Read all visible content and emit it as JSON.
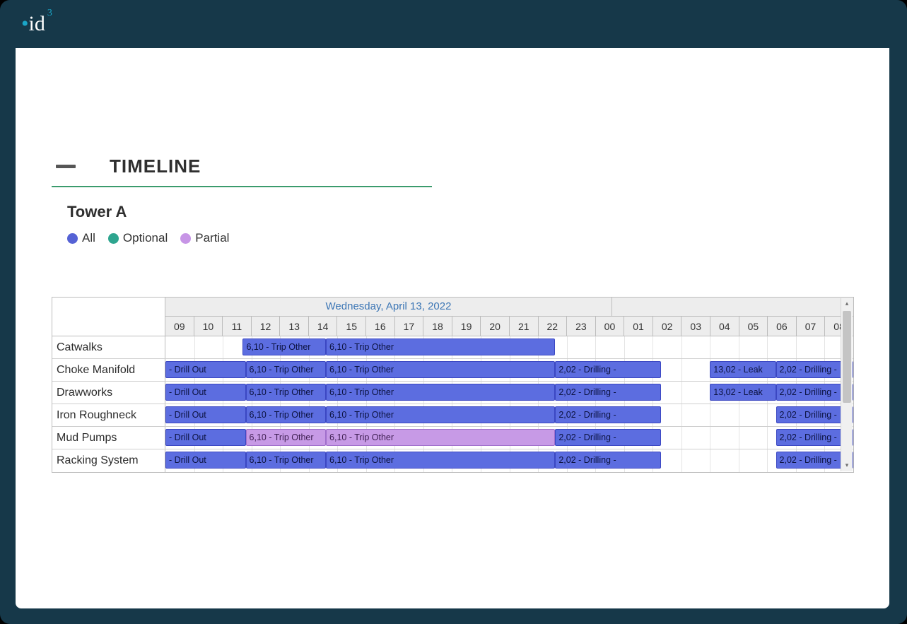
{
  "logo": {
    "text": "id",
    "sup": "3"
  },
  "section": {
    "title": "TIMELINE",
    "subtitle": "Tower A"
  },
  "legend": [
    {
      "label": "All",
      "class": "dot-all"
    },
    {
      "label": "Optional",
      "class": "dot-optional"
    },
    {
      "label": "Partial",
      "class": "dot-partial"
    }
  ],
  "dateLabel": "Wednesday, April 13, 2022",
  "hours": [
    "09",
    "10",
    "11",
    "12",
    "13",
    "14",
    "15",
    "16",
    "17",
    "18",
    "19",
    "20",
    "21",
    "22",
    "23",
    "00",
    "01",
    "02",
    "03",
    "04",
    "05",
    "06",
    "07",
    "08"
  ],
  "rows": [
    {
      "label": "Catwalks",
      "tasks": [
        {
          "text": "6,10 - Trip Other",
          "type": "all",
          "start": 2.7,
          "span": 2.9
        },
        {
          "text": "6,10 - Trip Other",
          "type": "all",
          "start": 5.6,
          "span": 8.0
        }
      ]
    },
    {
      "label": "Choke Manifold",
      "tasks": [
        {
          "text": "- Drill Out",
          "type": "all",
          "start": 0,
          "span": 2.8
        },
        {
          "text": "6,10 - Trip Other",
          "type": "all",
          "start": 2.8,
          "span": 2.8
        },
        {
          "text": "6,10 - Trip Other",
          "type": "all",
          "start": 5.6,
          "span": 8.0
        },
        {
          "text": "2,02 - Drilling -",
          "type": "all",
          "start": 13.6,
          "span": 3.7
        },
        {
          "text": "13,02 - Leak",
          "type": "all",
          "start": 19.0,
          "span": 2.3
        },
        {
          "text": "2,02 - Drilling -",
          "type": "all",
          "start": 21.3,
          "span": 2.7
        }
      ]
    },
    {
      "label": "Drawworks",
      "tasks": [
        {
          "text": "- Drill Out",
          "type": "all",
          "start": 0,
          "span": 2.8
        },
        {
          "text": "6,10 - Trip Other",
          "type": "all",
          "start": 2.8,
          "span": 2.8
        },
        {
          "text": "6,10 - Trip Other",
          "type": "all",
          "start": 5.6,
          "span": 8.0
        },
        {
          "text": "2,02 - Drilling -",
          "type": "all",
          "start": 13.6,
          "span": 3.7
        },
        {
          "text": "13,02 - Leak",
          "type": "all",
          "start": 19.0,
          "span": 2.3
        },
        {
          "text": "2,02 - Drilling -",
          "type": "all",
          "start": 21.3,
          "span": 2.7
        }
      ]
    },
    {
      "label": "Iron Roughneck",
      "tasks": [
        {
          "text": "- Drill Out",
          "type": "all",
          "start": 0,
          "span": 2.8
        },
        {
          "text": "6,10 - Trip Other",
          "type": "all",
          "start": 2.8,
          "span": 2.8
        },
        {
          "text": "6,10 - Trip Other",
          "type": "all",
          "start": 5.6,
          "span": 8.0
        },
        {
          "text": "2,02 - Drilling -",
          "type": "all",
          "start": 13.6,
          "span": 3.7
        },
        {
          "text": "2,02 - Drilling -",
          "type": "all",
          "start": 21.3,
          "span": 2.7
        }
      ]
    },
    {
      "label": "Mud Pumps",
      "tasks": [
        {
          "text": "- Drill Out",
          "type": "all",
          "start": 0,
          "span": 2.8
        },
        {
          "text": "6,10 - Trip Other",
          "type": "partial",
          "start": 2.8,
          "span": 2.8
        },
        {
          "text": "6,10 - Trip Other",
          "type": "partial",
          "start": 5.6,
          "span": 8.0
        },
        {
          "text": "2,02 - Drilling -",
          "type": "all",
          "start": 13.6,
          "span": 3.7
        },
        {
          "text": "2,02 - Drilling -",
          "type": "all",
          "start": 21.3,
          "span": 2.7
        }
      ]
    },
    {
      "label": "Racking System",
      "tasks": [
        {
          "text": "- Drill Out",
          "type": "all",
          "start": 0,
          "span": 2.8
        },
        {
          "text": "6,10 - Trip Other",
          "type": "all",
          "start": 2.8,
          "span": 2.8
        },
        {
          "text": "6,10 - Trip Other",
          "type": "all",
          "start": 5.6,
          "span": 8.0
        },
        {
          "text": "2,02 - Drilling -",
          "type": "all",
          "start": 13.6,
          "span": 3.7
        },
        {
          "text": "2,02 - Drilling -",
          "type": "all",
          "start": 21.3,
          "span": 2.7
        }
      ]
    }
  ],
  "chart_data": {
    "type": "gantt",
    "title": "TIMELINE — Tower A",
    "date": "Wednesday, April 13, 2022",
    "x_axis_hours": [
      "09",
      "10",
      "11",
      "12",
      "13",
      "14",
      "15",
      "16",
      "17",
      "18",
      "19",
      "20",
      "21",
      "22",
      "23",
      "00",
      "01",
      "02",
      "03",
      "04",
      "05",
      "06",
      "07",
      "08"
    ],
    "legend": [
      "All",
      "Optional",
      "Partial"
    ],
    "colors": {
      "All": "#5562d5",
      "Optional": "#2ea58f",
      "Partial": "#c795e6"
    },
    "series": [
      {
        "name": "Catwalks",
        "bars": [
          {
            "label": "6,10 - Trip Other",
            "category": "All",
            "start_hour": "11.7",
            "end_hour": "14.6"
          },
          {
            "label": "6,10 - Trip Other",
            "category": "All",
            "start_hour": "14.6",
            "end_hour": "22.6"
          }
        ]
      },
      {
        "name": "Choke Manifold",
        "bars": [
          {
            "label": "- Drill Out",
            "category": "All",
            "start_hour": "09.0",
            "end_hour": "11.8"
          },
          {
            "label": "6,10 - Trip Other",
            "category": "All",
            "start_hour": "11.8",
            "end_hour": "14.6"
          },
          {
            "label": "6,10 - Trip Other",
            "category": "All",
            "start_hour": "14.6",
            "end_hour": "22.6"
          },
          {
            "label": "2,02 - Drilling -",
            "category": "All",
            "start_hour": "22.6",
            "end_hour": "02.3"
          },
          {
            "label": "13,02 - Leak",
            "category": "All",
            "start_hour": "04.0",
            "end_hour": "06.3"
          },
          {
            "label": "2,02 - Drilling -",
            "category": "All",
            "start_hour": "06.3",
            "end_hour": "09.0"
          }
        ]
      },
      {
        "name": "Drawworks",
        "bars": [
          {
            "label": "- Drill Out",
            "category": "All",
            "start_hour": "09.0",
            "end_hour": "11.8"
          },
          {
            "label": "6,10 - Trip Other",
            "category": "All",
            "start_hour": "11.8",
            "end_hour": "14.6"
          },
          {
            "label": "6,10 - Trip Other",
            "category": "All",
            "start_hour": "14.6",
            "end_hour": "22.6"
          },
          {
            "label": "2,02 - Drilling -",
            "category": "All",
            "start_hour": "22.6",
            "end_hour": "02.3"
          },
          {
            "label": "13,02 - Leak",
            "category": "All",
            "start_hour": "04.0",
            "end_hour": "06.3"
          },
          {
            "label": "2,02 - Drilling -",
            "category": "All",
            "start_hour": "06.3",
            "end_hour": "09.0"
          }
        ]
      },
      {
        "name": "Iron Roughneck",
        "bars": [
          {
            "label": "- Drill Out",
            "category": "All",
            "start_hour": "09.0",
            "end_hour": "11.8"
          },
          {
            "label": "6,10 - Trip Other",
            "category": "All",
            "start_hour": "11.8",
            "end_hour": "14.6"
          },
          {
            "label": "6,10 - Trip Other",
            "category": "All",
            "start_hour": "14.6",
            "end_hour": "22.6"
          },
          {
            "label": "2,02 - Drilling -",
            "category": "All",
            "start_hour": "22.6",
            "end_hour": "02.3"
          },
          {
            "label": "2,02 - Drilling -",
            "category": "All",
            "start_hour": "06.3",
            "end_hour": "09.0"
          }
        ]
      },
      {
        "name": "Mud Pumps",
        "bars": [
          {
            "label": "- Drill Out",
            "category": "All",
            "start_hour": "09.0",
            "end_hour": "11.8"
          },
          {
            "label": "6,10 - Trip Other",
            "category": "Partial",
            "start_hour": "11.8",
            "end_hour": "14.6"
          },
          {
            "label": "6,10 - Trip Other",
            "category": "Partial",
            "start_hour": "14.6",
            "end_hour": "22.6"
          },
          {
            "label": "2,02 - Drilling -",
            "category": "All",
            "start_hour": "22.6",
            "end_hour": "02.3"
          },
          {
            "label": "2,02 - Drilling -",
            "category": "All",
            "start_hour": "06.3",
            "end_hour": "09.0"
          }
        ]
      },
      {
        "name": "Racking System",
        "bars": [
          {
            "label": "- Drill Out",
            "category": "All",
            "start_hour": "09.0",
            "end_hour": "11.8"
          },
          {
            "label": "6,10 - Trip Other",
            "category": "All",
            "start_hour": "11.8",
            "end_hour": "14.6"
          },
          {
            "label": "6,10 - Trip Other",
            "category": "All",
            "start_hour": "14.6",
            "end_hour": "22.6"
          },
          {
            "label": "2,02 - Drilling -",
            "category": "All",
            "start_hour": "22.6",
            "end_hour": "02.3"
          },
          {
            "label": "2,02 - Drilling -",
            "category": "All",
            "start_hour": "06.3",
            "end_hour": "09.0"
          }
        ]
      }
    ]
  }
}
